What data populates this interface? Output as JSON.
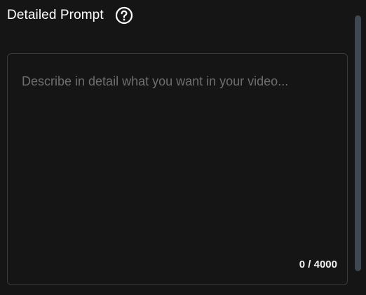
{
  "header": {
    "title": "Detailed Prompt",
    "help_icon": "question-circle-icon"
  },
  "prompt": {
    "value": "",
    "placeholder": "Describe in detail what you want in your video...",
    "char_count": "0 / 4000"
  },
  "colors": {
    "background": "#151515",
    "border": "#3a3a3a",
    "placeholder": "#6f6f6f",
    "scrollbar_thumb": "#3f4850"
  }
}
